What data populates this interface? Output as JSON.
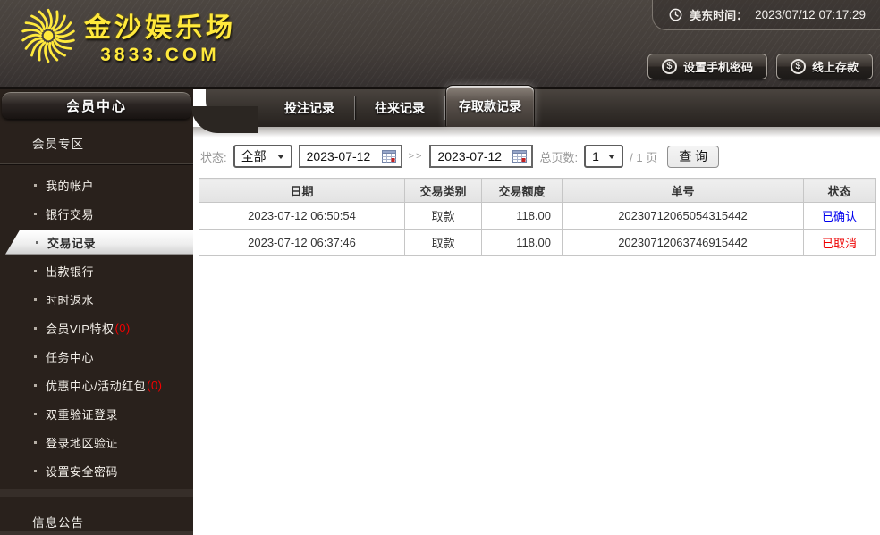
{
  "header": {
    "logo": {
      "title": "金沙娱乐场",
      "domain": "3833.COM"
    },
    "time": {
      "label": "美东时间：",
      "value": "2023/07/12 07:17:29"
    },
    "buttons": [
      {
        "label": "设置手机密码"
      },
      {
        "label": "线上存款"
      }
    ]
  },
  "sidebar": {
    "title": "会员中心",
    "section_member": "会员专区",
    "section_news": "信息公告",
    "items": [
      {
        "label": "我的帐户"
      },
      {
        "label": "银行交易"
      },
      {
        "label": "交易记录",
        "active": true
      },
      {
        "label": "出款银行"
      },
      {
        "label": "时时返水"
      },
      {
        "label": "会员VIP特权",
        "badge": "(0)"
      },
      {
        "label": "任务中心"
      },
      {
        "label": "优惠中心/活动红包",
        "badge": "(0)"
      },
      {
        "label": "双重验证登录"
      },
      {
        "label": "登录地区验证"
      },
      {
        "label": "设置安全密码"
      }
    ]
  },
  "tabs": [
    {
      "label": "投注记录"
    },
    {
      "label": "往来记录"
    },
    {
      "label": "存取款记录",
      "active": true
    }
  ],
  "filters": {
    "status_label": "状态:",
    "status_value": "全部",
    "date_from": "2023-07-12",
    "date_to": "2023-07-12",
    "range_separator": ">>",
    "pages_label": "总页数:",
    "page_value": "1",
    "pages_suffix": "/ 1 页",
    "search_label": "查 询"
  },
  "table": {
    "headers": [
      "日期",
      "交易类别",
      "交易额度",
      "单号",
      "状态"
    ],
    "rows": [
      {
        "date": "2023-07-12 06:50:54",
        "type": "取款",
        "amount": "118.00",
        "order_no": "20230712065054315442",
        "status": "已确认"
      },
      {
        "date": "2023-07-12 06:37:46",
        "type": "取款",
        "amount": "118.00",
        "order_no": "20230712063746915442",
        "status": "已取消"
      }
    ]
  },
  "colors": {
    "logo_yellow": "#ffe93c",
    "status_confirmed": "#0000ee",
    "status_cancelled": "#ee0000",
    "badge_red": "#f30000",
    "header_bg": "#443e3a",
    "sidebar_bg": "#29211c"
  }
}
